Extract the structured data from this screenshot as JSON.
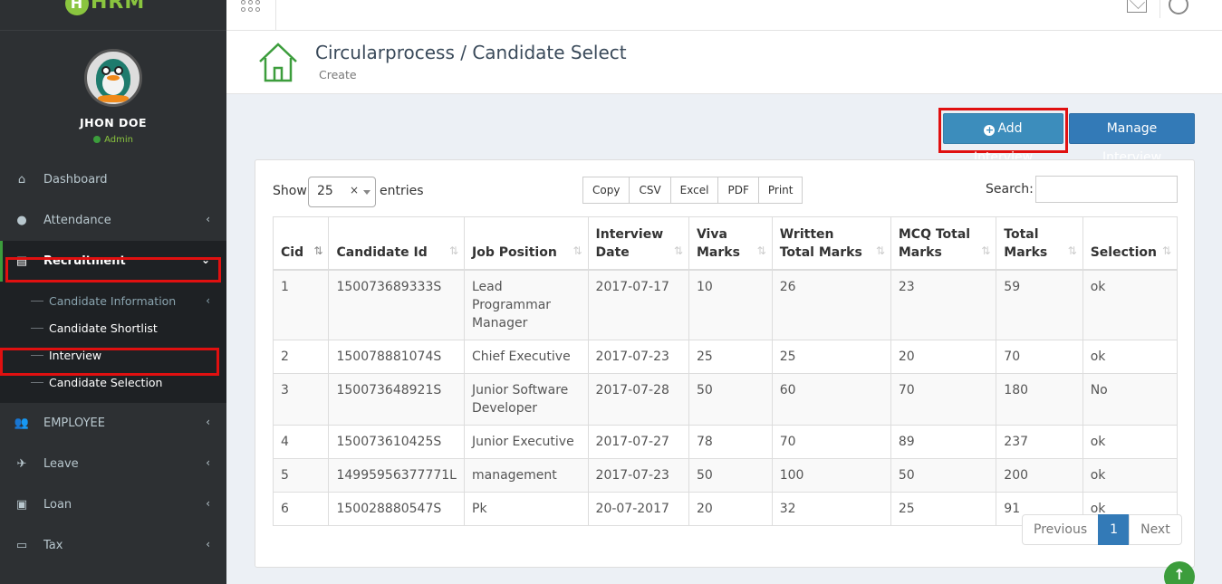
{
  "app": {
    "logo_text": "HRM",
    "logo_letter": "H"
  },
  "user": {
    "name": "JHON DOE",
    "role": "Admin"
  },
  "sidebar": {
    "items": [
      {
        "label": "Dashboard",
        "icon": "home-icon"
      },
      {
        "label": "Attendance",
        "icon": "user-icon"
      },
      {
        "label": "Recruitment",
        "icon": "newspaper-icon"
      },
      {
        "label": "EMPLOYEE",
        "icon": "users-icon"
      },
      {
        "label": "Leave",
        "icon": "plane-icon"
      },
      {
        "label": "Loan",
        "icon": "money-icon"
      },
      {
        "label": "Tax",
        "icon": "credit-card-icon"
      }
    ],
    "recruitment_sub": [
      {
        "label": "Candidate Information"
      },
      {
        "label": "Candidate Shortlist"
      },
      {
        "label": "Interview"
      },
      {
        "label": "Candidate Selection"
      }
    ]
  },
  "header": {
    "title": "Circularprocess / Candidate Select",
    "subtitle": "Create"
  },
  "actions": {
    "add_label": "Add Interview",
    "manage_label": "Manage Interview"
  },
  "table_controls": {
    "show_label": "Show",
    "entries_value": "25",
    "entries_label": "entries",
    "export_buttons": [
      "Copy",
      "CSV",
      "Excel",
      "PDF",
      "Print"
    ],
    "search_label": "Search:",
    "search_placeholder": ""
  },
  "table": {
    "columns": [
      "Cid",
      "Candidate Id",
      "Job Position",
      "Interview Date",
      "Viva Marks",
      "Written Total Marks",
      "MCQ Total Marks",
      "Total Marks",
      "Selection"
    ],
    "rows": [
      [
        "1",
        "150073689333S",
        "Lead Programmar Manager",
        "2017-07-17",
        "10",
        "26",
        "23",
        "59",
        "ok"
      ],
      [
        "2",
        "150078881074S",
        "Chief Executive",
        "2017-07-23",
        "25",
        "25",
        "20",
        "70",
        "ok"
      ],
      [
        "3",
        "150073648921S",
        "Junior Software Developer",
        "2017-07-28",
        "50",
        "60",
        "70",
        "180",
        "No"
      ],
      [
        "4",
        "150073610425S",
        "Junior Executive",
        "2017-07-27",
        "78",
        "70",
        "89",
        "237",
        "ok"
      ],
      [
        "5",
        "14995956377771L",
        "management",
        "2017-07-23",
        "50",
        "100",
        "50",
        "200",
        "ok"
      ],
      [
        "6",
        "150028880547S",
        "Pk",
        "20-07-2017",
        "20",
        "32",
        "25",
        "91",
        "ok"
      ]
    ]
  },
  "pagination": {
    "previous": "Previous",
    "current": "1",
    "next": "Next"
  },
  "colors": {
    "accent": "#3c8dbc",
    "brand_green": "#8ac53f",
    "sidebar_bg": "#2d3033",
    "highlight_red": "#e01010"
  }
}
